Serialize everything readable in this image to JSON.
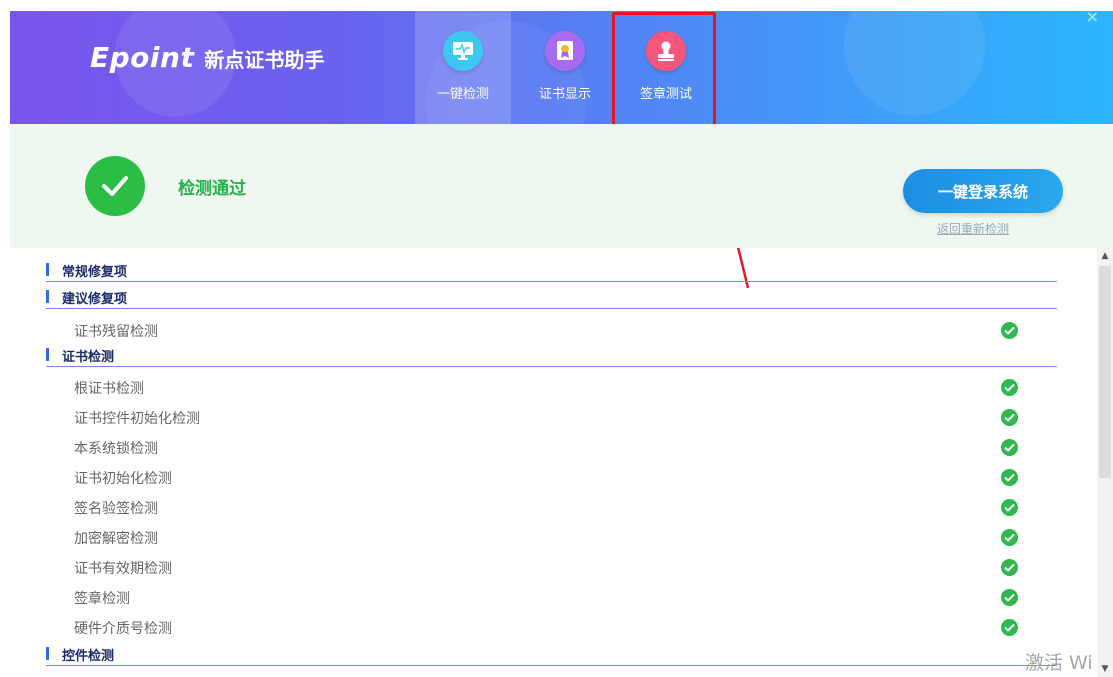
{
  "app": {
    "logo_text": "Epoint",
    "title": "新点证书助手",
    "close_symbol": "×"
  },
  "tabs": [
    {
      "label": "一键检测",
      "icon": "monitor-icon",
      "color": "#3ec7f1",
      "active": true
    },
    {
      "label": "证书显示",
      "icon": "certificate-icon",
      "color": "#a86af0",
      "active": false
    },
    {
      "label": "签章测试",
      "icon": "seal-stamp-icon",
      "color": "#f5567a",
      "active": false
    }
  ],
  "status": {
    "text": "检测通过",
    "login_button": "一键登录系统",
    "recheck_link": "返回重新检测"
  },
  "sections": [
    {
      "title": "常规修复项",
      "items": []
    },
    {
      "title": "建议修复项",
      "items": [
        "证书残留检测"
      ]
    },
    {
      "title": "证书检测",
      "items": [
        "根证书检测",
        "证书控件初始化检测",
        "本系统锁检测",
        "证书初始化检测",
        "签名验签检测",
        "加密解密检测",
        "证书有效期检测",
        "签章检测",
        "硬件介质号检测"
      ]
    },
    {
      "title": "控件检测",
      "items": []
    }
  ],
  "watermark": "激活 Wi",
  "colors": {
    "header_start": "#7a55ec",
    "header_end": "#2bb6fb",
    "pass_green": "#2cbd47",
    "login_blue": "#1d8de0",
    "highlight_red": "#e8171e",
    "section_line": "#6a89f4"
  }
}
